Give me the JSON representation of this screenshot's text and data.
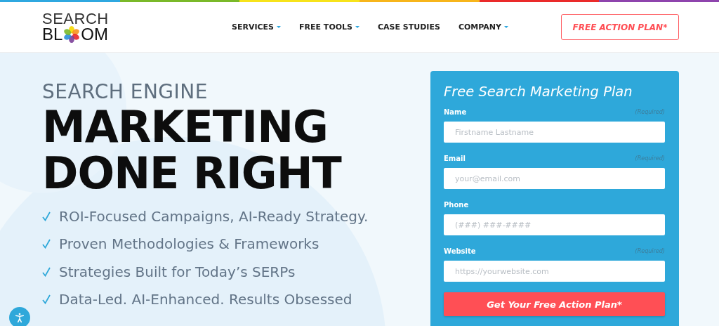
{
  "logo": {
    "top": "SEARCH",
    "bottom_start": "BL",
    "bottom_end": "OM"
  },
  "nav": [
    {
      "label": "SERVICES",
      "dropdown": true
    },
    {
      "label": "FREE TOOLS",
      "dropdown": true
    },
    {
      "label": "CASE STUDIES",
      "dropdown": false
    },
    {
      "label": "COMPANY",
      "dropdown": true
    }
  ],
  "cta": "FREE ACTION PLAN*",
  "hero": {
    "kicker": "SEARCH ENGINE",
    "headline": [
      "MARKETING",
      "DONE RIGHT"
    ],
    "bullets": [
      "ROI-Focused Campaigns, AI-Ready Strategy.",
      "Proven Methodologies & Frameworks",
      "Strategies Built for Today’s SERPs",
      "Data-Led. AI-Enhanced. Results Obsessed"
    ]
  },
  "form": {
    "title": "Free Search Marketing Plan",
    "fields": [
      {
        "label": "Name",
        "note": "(Required)",
        "placeholder": "Firstname Lastname"
      },
      {
        "label": "Email",
        "note": "(Required)",
        "placeholder": "your@email.com"
      },
      {
        "label": "Phone",
        "placeholder": "(###) ###-####"
      },
      {
        "label": "Website",
        "note": "(Required)",
        "placeholder": "https://yourwebsite.com"
      }
    ],
    "submit": "Get Your Free Action Plan*"
  }
}
